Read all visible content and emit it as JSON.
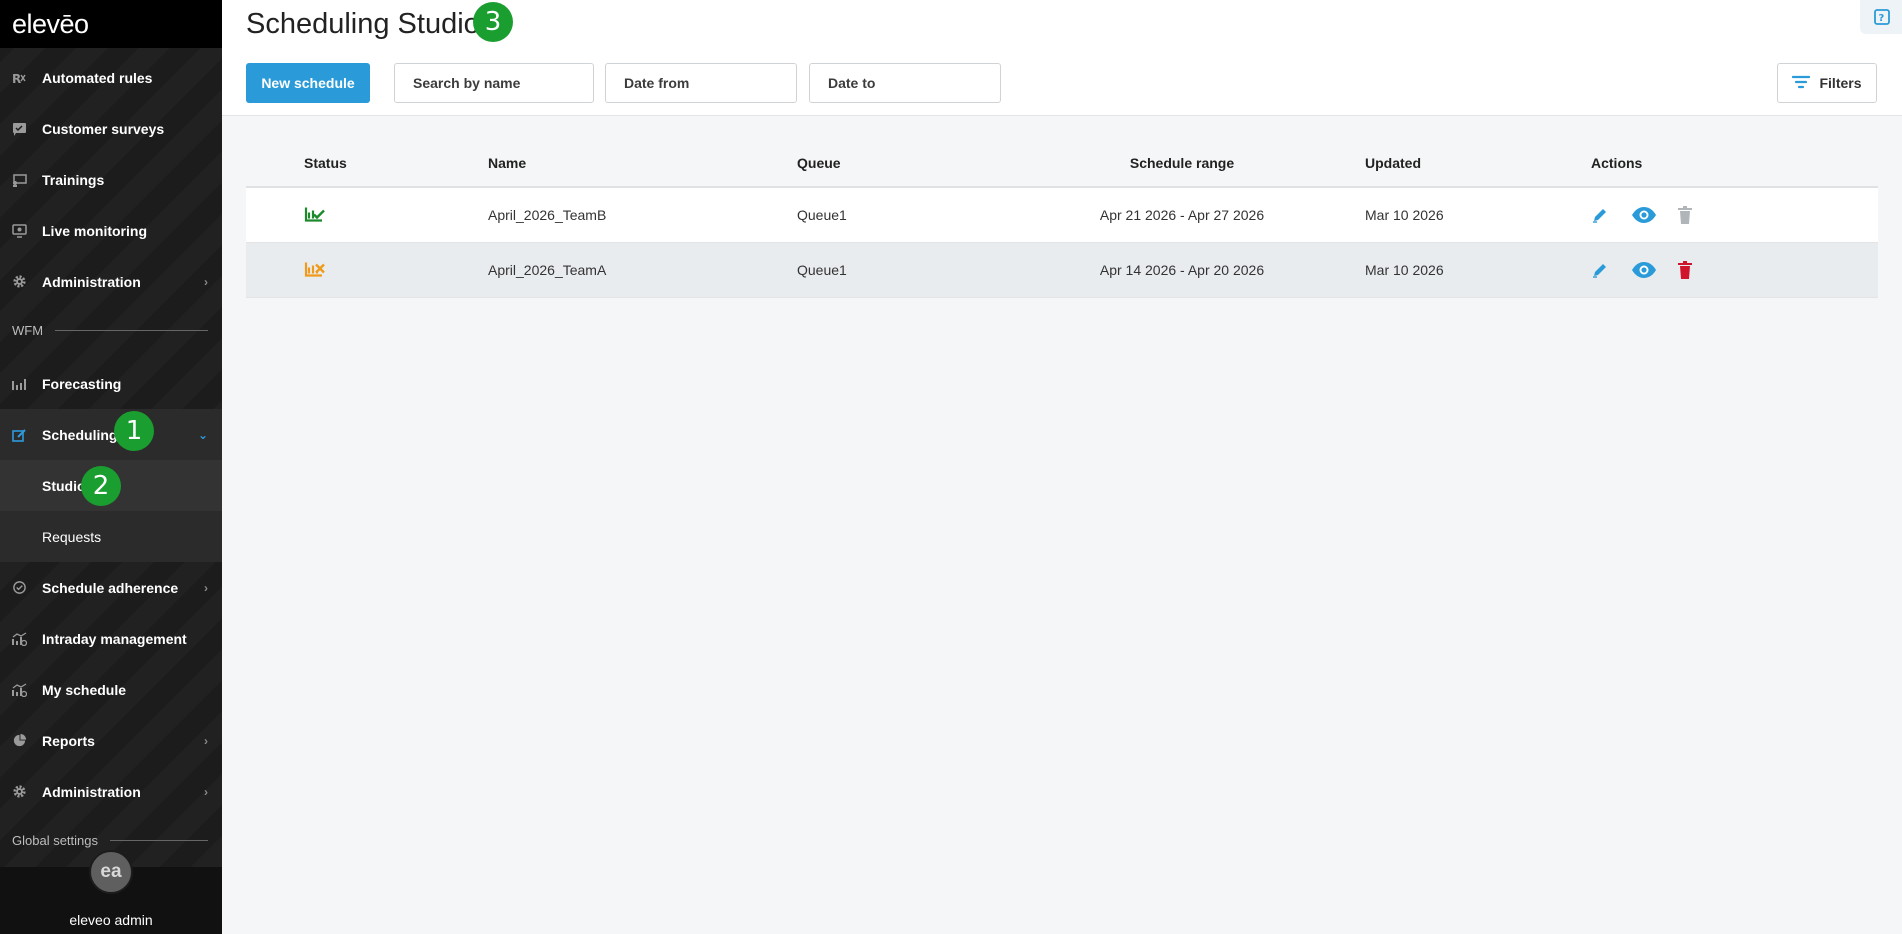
{
  "sidebar": {
    "logo": "elevēo",
    "items": [
      {
        "label": "Automated rules",
        "icon": "automated-rules-icon"
      },
      {
        "label": "Customer surveys",
        "icon": "survey-icon"
      },
      {
        "label": "Trainings",
        "icon": "training-icon"
      },
      {
        "label": "Live monitoring",
        "icon": "live-monitoring-icon"
      },
      {
        "label": "Administration",
        "icon": "gear-icon"
      }
    ],
    "wfm_label": "WFM",
    "wfm_items": [
      {
        "label": "Forecasting",
        "icon": "forecast-chart-icon"
      },
      {
        "label": "Scheduling",
        "icon": "edit-icon"
      },
      {
        "label": "Studio"
      },
      {
        "label": "Requests"
      },
      {
        "label": "Schedule adherence",
        "icon": "check-circle-icon"
      },
      {
        "label": "Intraday management",
        "icon": "chart-icon"
      },
      {
        "label": "My schedule",
        "icon": "chart-icon"
      },
      {
        "label": "Reports",
        "icon": "pie-chart-icon"
      },
      {
        "label": "Administration",
        "icon": "gear-icon"
      }
    ],
    "global_settings_label": "Global settings",
    "user": {
      "initials": "ea",
      "name": "eleveo admin"
    }
  },
  "badges": {
    "b1": "1",
    "b2": "2",
    "b3": "3"
  },
  "header": {
    "title": "Scheduling Studio",
    "new_schedule_label": "New schedule",
    "search_placeholder": "Search by name",
    "date_from_placeholder": "Date from",
    "date_to_placeholder": "Date to",
    "filters_label": "Filters"
  },
  "table": {
    "columns": [
      "Status",
      "Name",
      "Queue",
      "Schedule range",
      "Updated",
      "Actions"
    ],
    "rows": [
      {
        "status": "published",
        "status_color": "#1e8a2e",
        "name": "April_2026_TeamB",
        "queue": "Queue1",
        "range": "Apr 21 2026 - Apr 27 2026",
        "updated": "Mar 10 2026",
        "delete_enabled": false
      },
      {
        "status": "failed",
        "status_color": "#f09a1a",
        "name": "April_2026_TeamA",
        "queue": "Queue1",
        "range": "Apr 14 2026 - Apr 20 2026",
        "updated": "Mar 10 2026",
        "delete_enabled": true
      }
    ]
  },
  "colors": {
    "accent": "#2a9bd8",
    "badge": "#1a9e2f",
    "delete": "#d0142c",
    "delete_disabled": "#b0b5b9"
  }
}
